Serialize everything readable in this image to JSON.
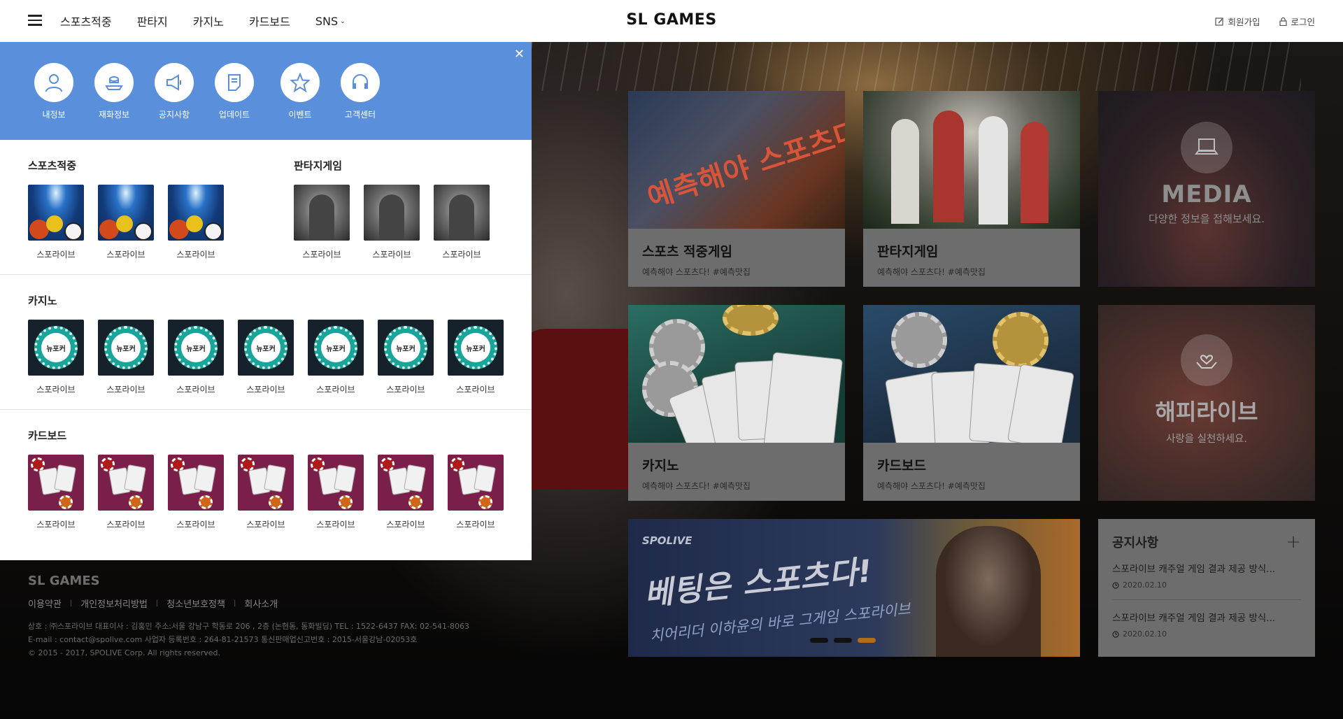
{
  "header": {
    "menu_icon": "hamburger-icon",
    "nav": [
      {
        "label": "스포츠적중"
      },
      {
        "label": "판타지"
      },
      {
        "label": "카지노"
      },
      {
        "label": "카드보드"
      },
      {
        "label": "SNS",
        "has_dropdown": true
      }
    ],
    "logo": "SL GAMES",
    "signup_label": "회원가입",
    "signup_icon": "edit-icon",
    "login_label": "로그인",
    "login_icon": "lock-icon"
  },
  "panel": {
    "accent": "#5a8fdc",
    "close_icon": "close-icon",
    "shortcuts": [
      {
        "label": "내정보",
        "icon": "user-icon"
      },
      {
        "label": "재화정보",
        "icon": "hand-coin-icon"
      },
      {
        "label": "공지사항",
        "icon": "megaphone-icon"
      },
      {
        "label": "업데이트",
        "icon": "document-icon"
      },
      {
        "label": "이벤트",
        "icon": "star-icon"
      },
      {
        "label": "고객센터",
        "icon": "headset-icon"
      }
    ],
    "sections": {
      "sports": {
        "title": "스포츠적중",
        "games": [
          "스포라이브",
          "스포라이브",
          "스포라이브"
        ]
      },
      "fantasy": {
        "title": "판타지게임",
        "games": [
          "스포라이브",
          "스포라이브",
          "스포라이브"
        ]
      },
      "casino": {
        "title": "카지노",
        "thumb_text": "뉴포커",
        "games": [
          "스포라이브",
          "스포라이브",
          "스포라이브",
          "스포라이브",
          "스포라이브",
          "스포라이브",
          "스포라이브"
        ]
      },
      "cardboard": {
        "title": "카드보드",
        "games": [
          "스포라이브",
          "스포라이브",
          "스포라이브",
          "스포라이브",
          "스포라이브",
          "스포라이브",
          "스포라이브"
        ]
      }
    }
  },
  "cards": {
    "sports": {
      "title": "스포츠 적중게임",
      "sub": "예측해야 스포츠다! #예측맛집",
      "image_text": "예측해야 스포츠다!"
    },
    "fantasy": {
      "title": "판타지게임",
      "sub": "예측해야 스포츠다! #예측맛집"
    },
    "casino": {
      "title": "카지노",
      "sub": "예측해야 스포츠다! #예측맛집"
    },
    "cardboard": {
      "title": "카드보드",
      "sub": "예측해야 스포츠다! #예측맛집"
    },
    "media": {
      "title": "MEDIA",
      "sub": "다양한 정보을 접해보세요.",
      "icon": "laptop-icon"
    },
    "happy": {
      "title": "해피라이브",
      "sub": "사랑을 실천하세요.",
      "icon": "heart-hands-icon"
    }
  },
  "banner": {
    "brand": "SPOLIVE",
    "headline": "베팅은 스포츠다!",
    "subline": "치어리더 이하윤의 바로 그게임 스포라이브",
    "active_slide": 3,
    "slide_count": 3
  },
  "notice": {
    "title": "공지사항",
    "more_icon": "plus-icon",
    "items": [
      {
        "text": "스포라이브 캐주얼 게임 결과 제공 방식...",
        "date": "2020.02.10"
      },
      {
        "text": "스포라이브 캐주얼 게임 결과 제공 방식...",
        "date": "2020.02.10"
      }
    ]
  },
  "footer": {
    "logo": "SL GAMES",
    "links": [
      "이용약관",
      "개인정보처리방법",
      "청소년보호정책",
      "회사소개"
    ],
    "info_line1": "상호 : ㈜스포라이브 대표이사 : 김홍민 주소:서울 강남구 학동로 206 , 2층 (논현동, 동화빌딩) TEL : 1522-6437 FAX: 02-541-8063",
    "info_line2": "E-mail : contact@spolive.com 사업자 등록번호 : 264-81-21573 통신판매업신고번호 : 2015-서울강남-02053호",
    "info_line3": "© 2015 - 2017, SPOLIVE Corp. All rights reserved."
  }
}
